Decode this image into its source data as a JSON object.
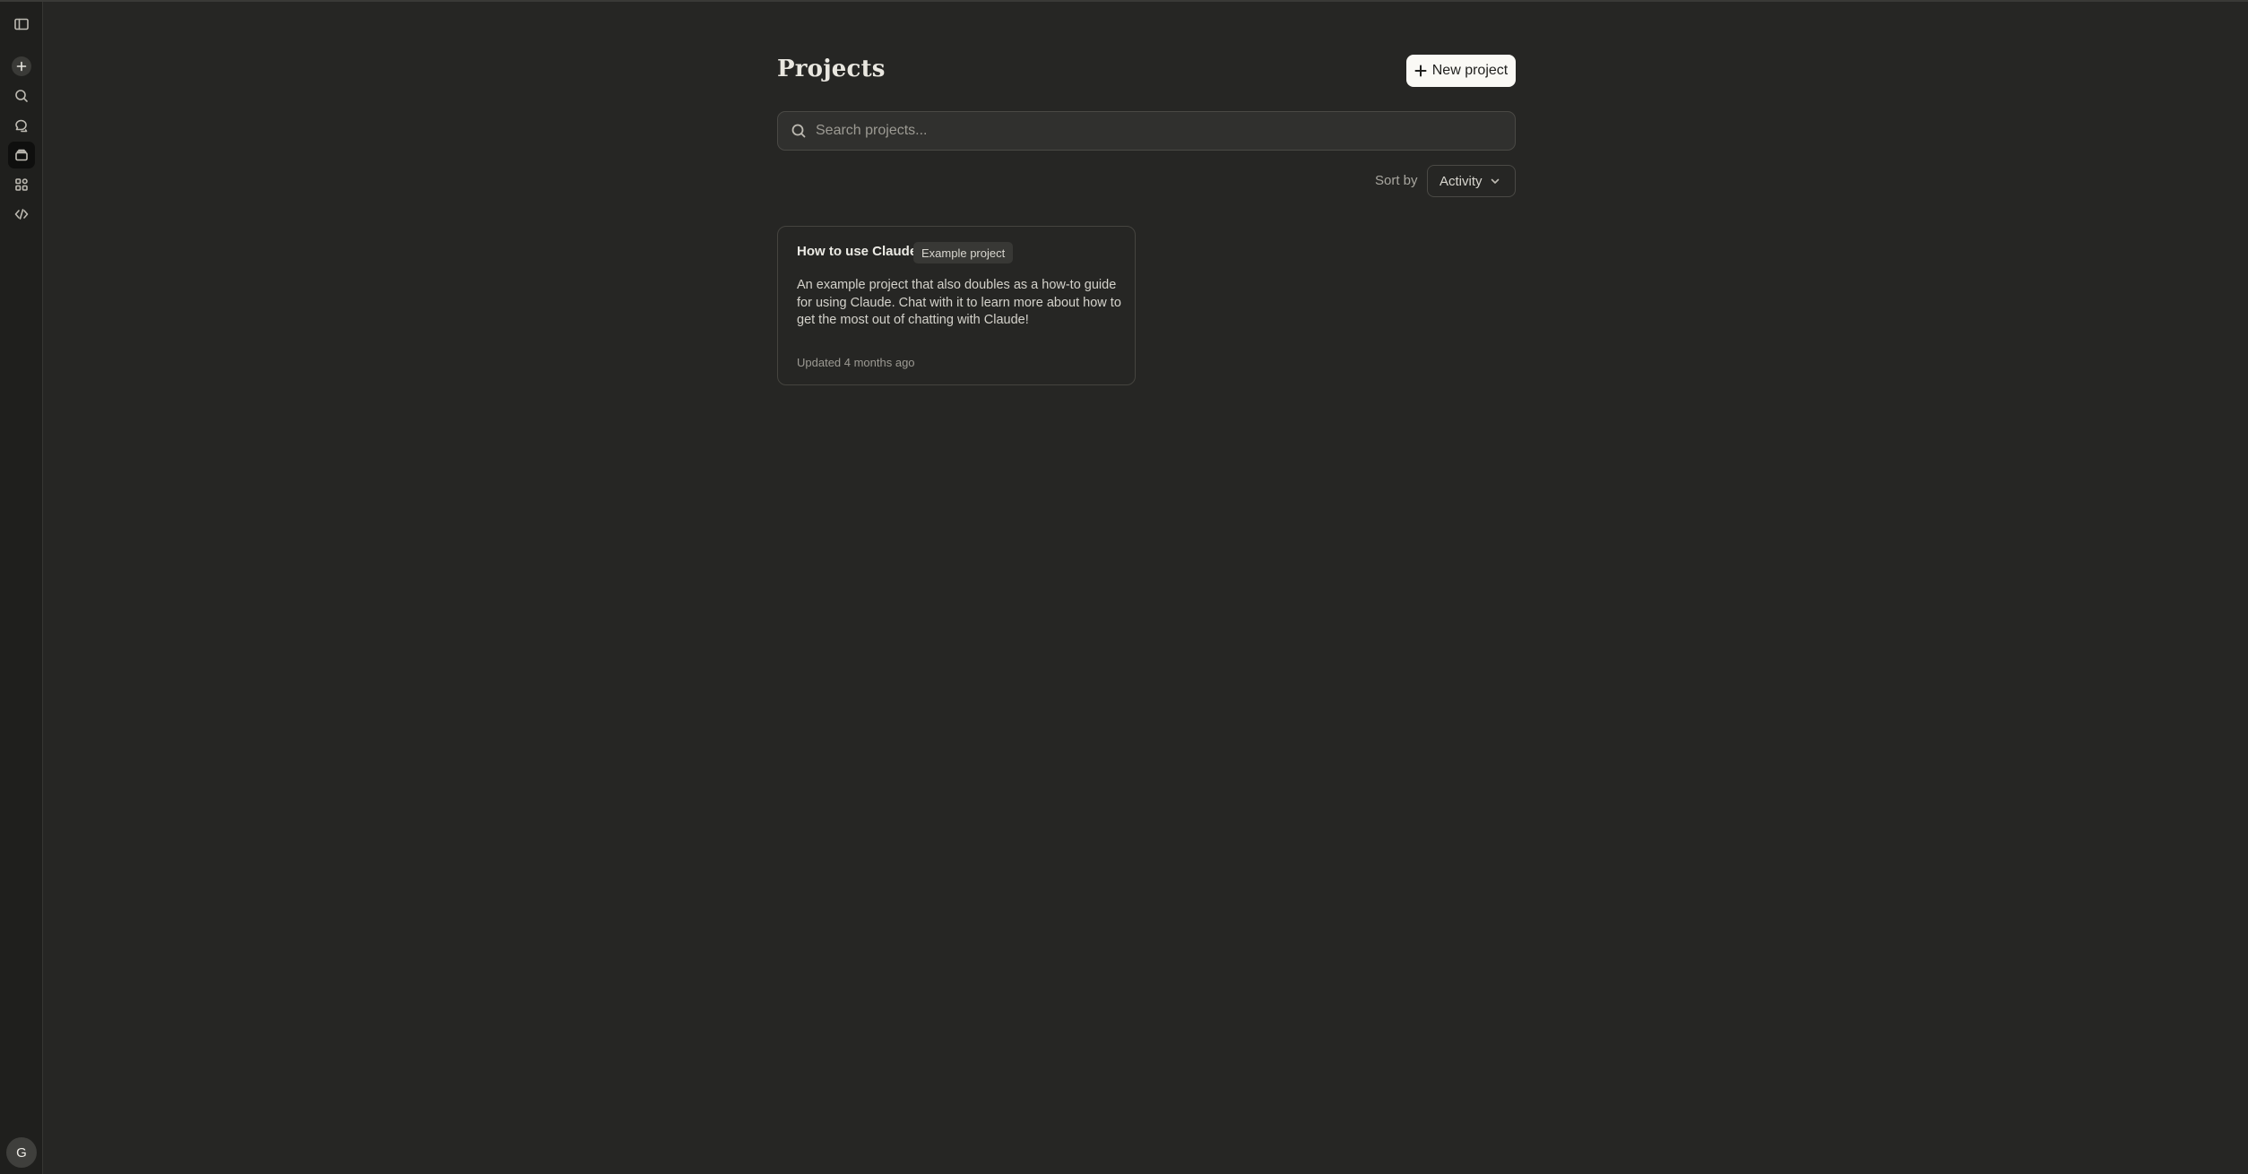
{
  "sidebar": {
    "items": [
      {
        "icon": "sidebar-toggle-icon"
      },
      {
        "icon": "plus-icon"
      },
      {
        "icon": "search-icon"
      },
      {
        "icon": "chats-icon"
      },
      {
        "icon": "projects-icon",
        "active": true
      },
      {
        "icon": "artifacts-icon"
      },
      {
        "icon": "code-icon"
      }
    ],
    "avatar_initial": "G"
  },
  "header": {
    "title": "Projects",
    "new_project_label": "New project"
  },
  "search": {
    "placeholder": "Search projects..."
  },
  "sort": {
    "label": "Sort by",
    "selected": "Activity"
  },
  "projects": [
    {
      "title": "How to use Claude",
      "badge": "Example project",
      "description": "An example project that also doubles as a how-to guide for using Claude. Chat with it to learn more about how to get the most out of chatting with Claude!",
      "updated": "Updated 4 months ago"
    }
  ],
  "colors": {
    "background": "#262624",
    "sidebar": "#1f1f1d",
    "primary_button": "#faf9f5"
  }
}
